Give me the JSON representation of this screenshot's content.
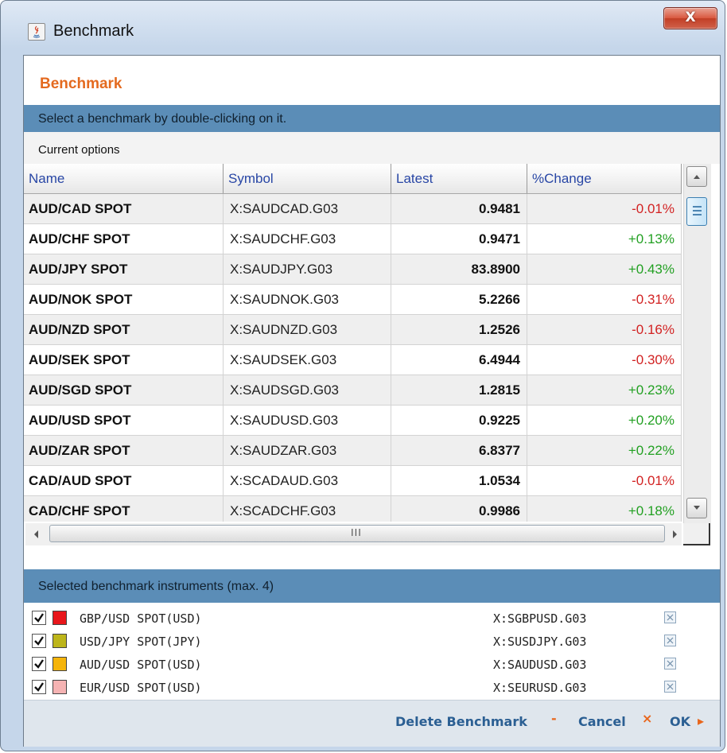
{
  "window": {
    "title": "Benchmark",
    "close_glyph": "X"
  },
  "dialog": {
    "heading": "Benchmark",
    "instruction": "Select a benchmark by double-clicking on it.",
    "current_options_label": "Current options"
  },
  "table": {
    "columns": [
      "Name",
      "Symbol",
      "Latest",
      "%Change"
    ],
    "rows": [
      {
        "name": "AUD/CAD SPOT",
        "symbol": "X:SAUDCAD.G03",
        "latest": "0.9481",
        "change": "-0.01%"
      },
      {
        "name": "AUD/CHF SPOT",
        "symbol": "X:SAUDCHF.G03",
        "latest": "0.9471",
        "change": "+0.13%"
      },
      {
        "name": "AUD/JPY SPOT",
        "symbol": "X:SAUDJPY.G03",
        "latest": "83.8900",
        "change": "+0.43%"
      },
      {
        "name": "AUD/NOK SPOT",
        "symbol": "X:SAUDNOK.G03",
        "latest": "5.2266",
        "change": "-0.31%"
      },
      {
        "name": "AUD/NZD SPOT",
        "symbol": "X:SAUDNZD.G03",
        "latest": "1.2526",
        "change": "-0.16%"
      },
      {
        "name": "AUD/SEK SPOT",
        "symbol": "X:SAUDSEK.G03",
        "latest": "6.4944",
        "change": "-0.30%"
      },
      {
        "name": "AUD/SGD SPOT",
        "symbol": "X:SAUDSGD.G03",
        "latest": "1.2815",
        "change": "+0.23%"
      },
      {
        "name": "AUD/USD SPOT",
        "symbol": "X:SAUDUSD.G03",
        "latest": "0.9225",
        "change": "+0.20%"
      },
      {
        "name": "AUD/ZAR SPOT",
        "symbol": "X:SAUDZAR.G03",
        "latest": "6.8377",
        "change": "+0.22%"
      },
      {
        "name": "CAD/AUD SPOT",
        "symbol": "X:SCADAUD.G03",
        "latest": "1.0534",
        "change": "-0.01%"
      },
      {
        "name": "CAD/CHF SPOT",
        "symbol": "X:SCADCHF.G03",
        "latest": "0.9986",
        "change": "+0.18%"
      }
    ],
    "hscroll_grip": "III"
  },
  "selected": {
    "title": "Selected benchmark instruments (max. 4)",
    "items": [
      {
        "label": "GBP/USD SPOT(USD)",
        "symbol": "X:SGBPUSD.G03",
        "color": "#e8161b",
        "checked": true
      },
      {
        "label": "USD/JPY SPOT(JPY)",
        "symbol": "X:SUSDJPY.G03",
        "color": "#bdb51a",
        "checked": true
      },
      {
        "label": "AUD/USD SPOT(USD)",
        "symbol": "X:SAUDUSD.G03",
        "color": "#f5b40a",
        "checked": true
      },
      {
        "label": "EUR/USD SPOT(USD)",
        "symbol": "X:SEURUSD.G03",
        "color": "#f5b3b3",
        "checked": true
      }
    ]
  },
  "footer": {
    "delete_label": "Delete Benchmark",
    "delete_icon": "-",
    "cancel_label": "Cancel",
    "cancel_icon": "×",
    "ok_label": "OK",
    "ok_icon": "▸"
  },
  "colors": {
    "accent_orange": "#e46a1f",
    "header_bar": "#5b8db7",
    "positive": "#22a022",
    "negative": "#d22222",
    "link_blue": "#2b5f93"
  }
}
